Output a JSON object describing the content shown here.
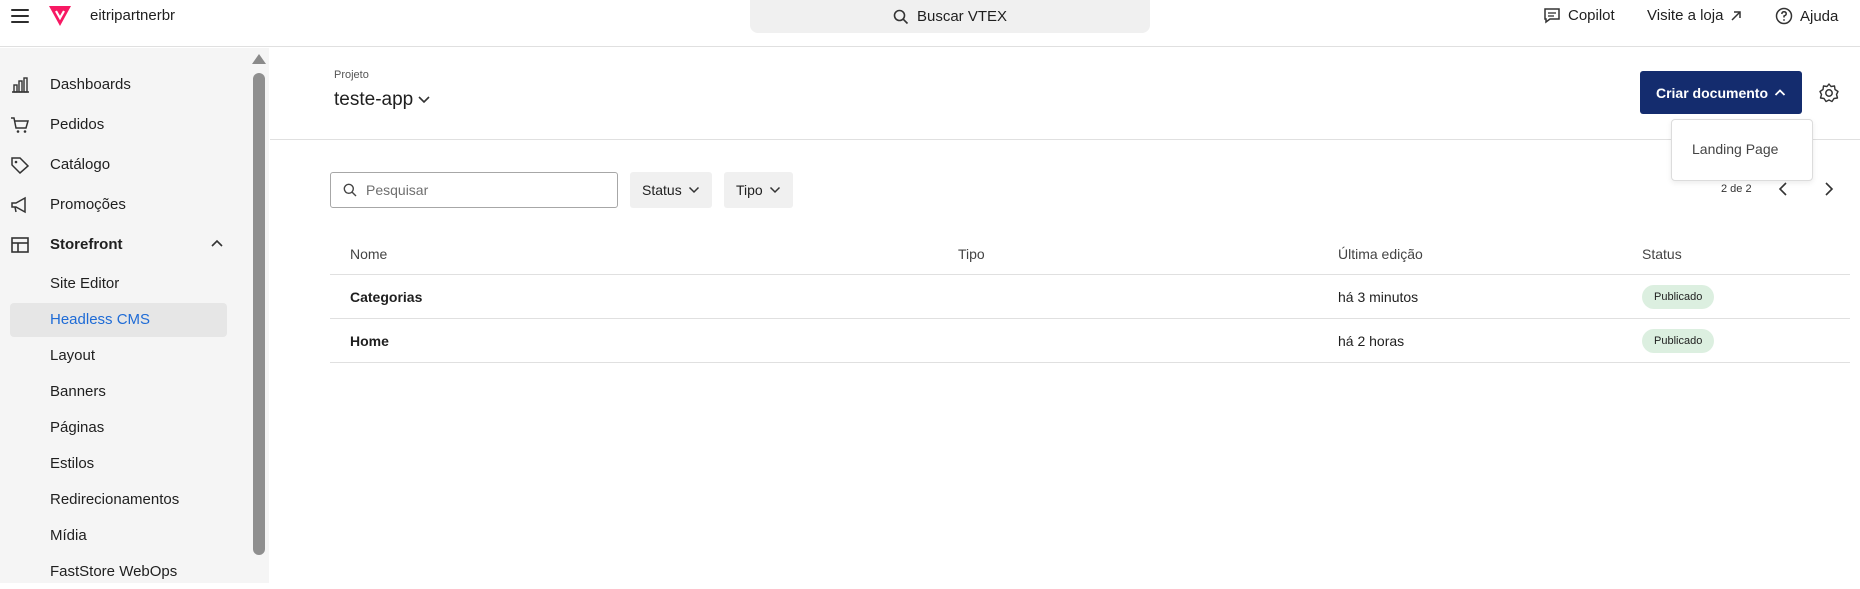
{
  "topbar": {
    "account": "eitripartnerbr",
    "search_label": "Buscar VTEX",
    "copilot": "Copilot",
    "visit_store": "Visite a loja",
    "help": "Ajuda"
  },
  "sidebar": {
    "items": [
      {
        "label": "Dashboards",
        "icon": "bar-chart-icon"
      },
      {
        "label": "Pedidos",
        "icon": "cart-icon"
      },
      {
        "label": "Catálogo",
        "icon": "tag-icon"
      },
      {
        "label": "Promoções",
        "icon": "megaphone-icon"
      },
      {
        "label": "Storefront",
        "icon": "layout-icon"
      }
    ],
    "subitems": [
      "Site Editor",
      "Headless CMS",
      "Layout",
      "Banners",
      "Páginas",
      "Estilos",
      "Redirecionamentos",
      "Mídia",
      "FastStore WebOps"
    ],
    "active_subitem": "Headless CMS"
  },
  "header": {
    "project_label": "Projeto",
    "project_name": "teste-app",
    "create_button": "Criar documento"
  },
  "dropdown": {
    "options": [
      "Landing Page"
    ]
  },
  "filters": {
    "search_placeholder": "Pesquisar",
    "status": "Status",
    "tipo": "Tipo"
  },
  "pagination": {
    "label": "2 de 2"
  },
  "table": {
    "columns": [
      "Nome",
      "Tipo",
      "Última edição",
      "Status"
    ],
    "rows": [
      {
        "nome": "Categorias",
        "tipo": "",
        "ultima_edicao": "há 3 minutos",
        "status": "Publicado"
      },
      {
        "nome": "Home",
        "tipo": "",
        "ultima_edicao": "há 2 horas",
        "status": "Publicado"
      }
    ]
  },
  "colors": {
    "brand": "#f71963",
    "primary_button": "#142c6e",
    "active_link": "#1e6bd6",
    "status_badge_bg": "#dcefe0"
  }
}
